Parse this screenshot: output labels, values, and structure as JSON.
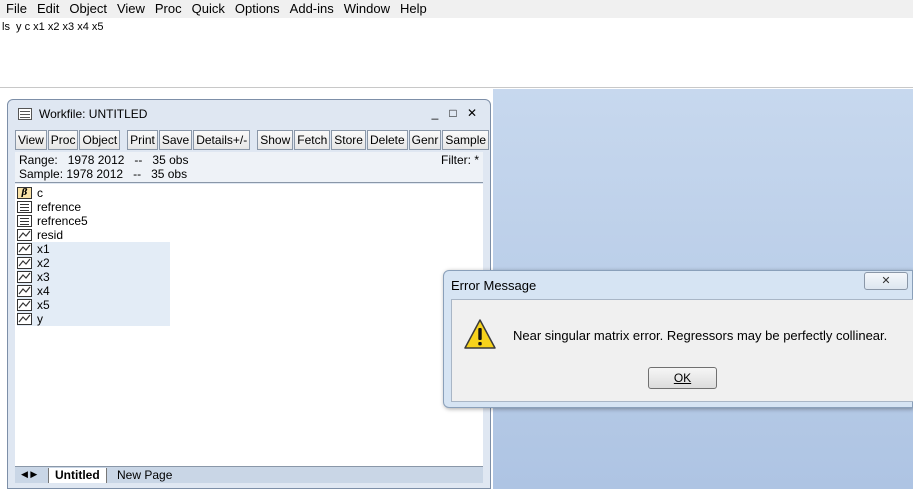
{
  "menubar": {
    "items": [
      "File",
      "Edit",
      "Object",
      "View",
      "Proc",
      "Quick",
      "Options",
      "Add-ins",
      "Window",
      "Help"
    ]
  },
  "command": {
    "text": "ls  y c x1 x2 x3 x4 x5"
  },
  "workfile": {
    "title": "Workfile: UNTITLED",
    "controls": {
      "minimize": "_",
      "maximize": "□",
      "close": "✕"
    },
    "toolbar": [
      "View",
      "Proc",
      "Object",
      "Print",
      "Save",
      "Details+/-",
      "Show",
      "Fetch",
      "Store",
      "Delete",
      "Genr",
      "Sample"
    ],
    "range": "Range:   1978 2012   --   35 obs",
    "sample": "Sample: 1978 2012   --   35 obs",
    "filter": "Filter: *",
    "objects": [
      {
        "name": "c",
        "icon": "coef-icon"
      },
      {
        "name": "refrence",
        "icon": "equation-icon"
      },
      {
        "name": "refrence5",
        "icon": "equation-icon"
      },
      {
        "name": "resid",
        "icon": "series-icon"
      },
      {
        "name": "x1",
        "icon": "series-icon"
      },
      {
        "name": "x2",
        "icon": "series-icon"
      },
      {
        "name": "x3",
        "icon": "series-icon"
      },
      {
        "name": "x4",
        "icon": "series-icon"
      },
      {
        "name": "x5",
        "icon": "series-icon"
      },
      {
        "name": "y",
        "icon": "series-icon"
      }
    ],
    "coef_glyph": "β",
    "tabs": {
      "arrows": "◀ ▶",
      "active": "Untitled",
      "new_page": "New Page"
    }
  },
  "dialog": {
    "title": "Error Message",
    "close": "✕",
    "message": "Near singular matrix error. Regressors may be perfectly collinear.",
    "ok_label": "OK"
  },
  "colors": {
    "desktop": "#aec4e3",
    "selected_row": "#e3ecf6",
    "warning_yellow": "#f7d31c"
  }
}
